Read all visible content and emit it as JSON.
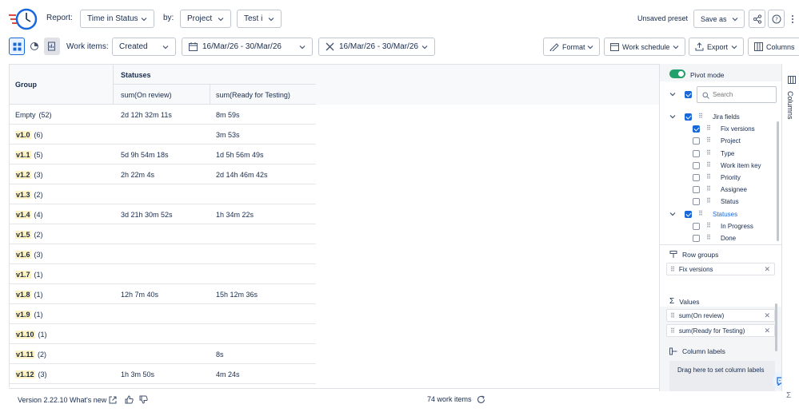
{
  "header": {
    "report_label": "Report:",
    "report_value": "Time in Status",
    "by_label": "by:",
    "by_value": "Project",
    "filter_value": "Test i",
    "preset_status": "Unsaved preset",
    "save_as_label": "Save as"
  },
  "toolbar": {
    "work_items_label": "Work items:",
    "work_items_value": "Created",
    "date_range_1": "16/Mar/26 - 30/Mar/26",
    "date_range_2": "16/Mar/26 - 30/Mar/26",
    "format_label": "Format",
    "work_schedule_label": "Work schedule",
    "export_label": "Export",
    "columns_label": "Columns"
  },
  "grid": {
    "group_header": "Group",
    "statuses_header": "Statuses",
    "col1_header": "sum(On review)",
    "col2_header": "sum(Ready for Testing)",
    "rows": [
      {
        "group": "Empty",
        "count": "(52)",
        "hl": false,
        "on_review": "2d 12h 32m 11s",
        "ready": "8m 59s"
      },
      {
        "group": "v1.0",
        "count": "(6)",
        "hl": true,
        "on_review": "",
        "ready": "3m 53s"
      },
      {
        "group": "v1.1",
        "count": "(5)",
        "hl": true,
        "on_review": "5d 9h 54m 18s",
        "ready": "1d 5h 56m 49s"
      },
      {
        "group": "v1.2",
        "count": "(3)",
        "hl": true,
        "on_review": "2h 22m 4s",
        "ready": "2d 14h 46m 42s"
      },
      {
        "group": "v1.3",
        "count": "(2)",
        "hl": true,
        "on_review": "",
        "ready": ""
      },
      {
        "group": "v1.4",
        "count": "(4)",
        "hl": true,
        "on_review": "3d 21h 30m 52s",
        "ready": "1h 34m 22s"
      },
      {
        "group": "v1.5",
        "count": "(2)",
        "hl": true,
        "on_review": "",
        "ready": ""
      },
      {
        "group": "v1.6",
        "count": "(3)",
        "hl": true,
        "on_review": "",
        "ready": ""
      },
      {
        "group": "v1.7",
        "count": "(1)",
        "hl": true,
        "on_review": "",
        "ready": ""
      },
      {
        "group": "v1.8",
        "count": "(1)",
        "hl": true,
        "on_review": "12h 7m 40s",
        "ready": "15h 12m 36s"
      },
      {
        "group": "v1.9",
        "count": "(1)",
        "hl": true,
        "on_review": "",
        "ready": ""
      },
      {
        "group": "v1.10",
        "count": "(1)",
        "hl": true,
        "on_review": "",
        "ready": ""
      },
      {
        "group": "v1.11",
        "count": "(2)",
        "hl": true,
        "on_review": "",
        "ready": "8s"
      },
      {
        "group": "v1.12",
        "count": "(3)",
        "hl": true,
        "on_review": "1h 3m 50s",
        "ready": "4m 24s"
      }
    ]
  },
  "footer": {
    "version_text": "Version 2.22.10 What's new",
    "work_items_count": "74 work items"
  },
  "panel": {
    "pivot_mode_label": "Pivot mode",
    "search_placeholder": "Search",
    "tree": [
      {
        "label": "Jira fields",
        "level": 0,
        "checked": true,
        "expanded": true,
        "link": false
      },
      {
        "label": "Fix versions",
        "level": 1,
        "checked": true,
        "expanded": false,
        "link": false
      },
      {
        "label": "Project",
        "level": 1,
        "checked": false,
        "expanded": false,
        "link": false
      },
      {
        "label": "Type",
        "level": 1,
        "checked": false,
        "expanded": false,
        "link": false
      },
      {
        "label": "Work item key",
        "level": 1,
        "checked": false,
        "expanded": false,
        "link": false
      },
      {
        "label": "Priority",
        "level": 1,
        "checked": false,
        "expanded": false,
        "link": false
      },
      {
        "label": "Assignee",
        "level": 1,
        "checked": false,
        "expanded": false,
        "link": false
      },
      {
        "label": "Status",
        "level": 1,
        "checked": false,
        "expanded": false,
        "link": false
      },
      {
        "label": "Statuses",
        "level": 0,
        "checked": true,
        "expanded": true,
        "link": true
      },
      {
        "label": "In Progress",
        "level": 1,
        "checked": false,
        "expanded": false,
        "link": false
      },
      {
        "label": "Done",
        "level": 1,
        "checked": false,
        "expanded": false,
        "link": false
      }
    ],
    "row_groups_title": "Row groups",
    "row_groups": [
      "Fix versions"
    ],
    "values_title": "Values",
    "values": [
      "sum(On review)",
      "sum(Ready for Testing)"
    ],
    "column_labels_title": "Column labels",
    "column_labels_hint": "Drag here to set column labels"
  },
  "sidetab": {
    "label": "Columns"
  },
  "colors": {
    "accent": "#1868db",
    "highlight": "#fff3c4",
    "toggle": "#22a06b"
  }
}
